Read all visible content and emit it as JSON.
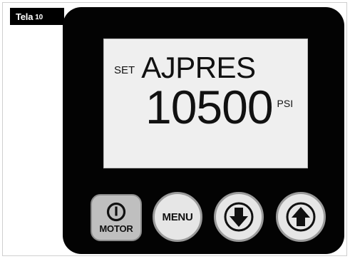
{
  "tag": {
    "text": "Tela",
    "number": "10"
  },
  "display": {
    "mode_label": "SET",
    "parameter": "AJPRES",
    "value": "10500",
    "unit": "PSI"
  },
  "buttons": {
    "motor_label": "MOTOR",
    "menu_label": "MENU",
    "down_icon": "arrow-down-icon",
    "up_icon": "arrow-up-icon",
    "power_icon": "power-icon"
  },
  "colors": {
    "panel": "#030303",
    "lcd_background": "#efefef",
    "button_face": "#e6e6e6"
  }
}
